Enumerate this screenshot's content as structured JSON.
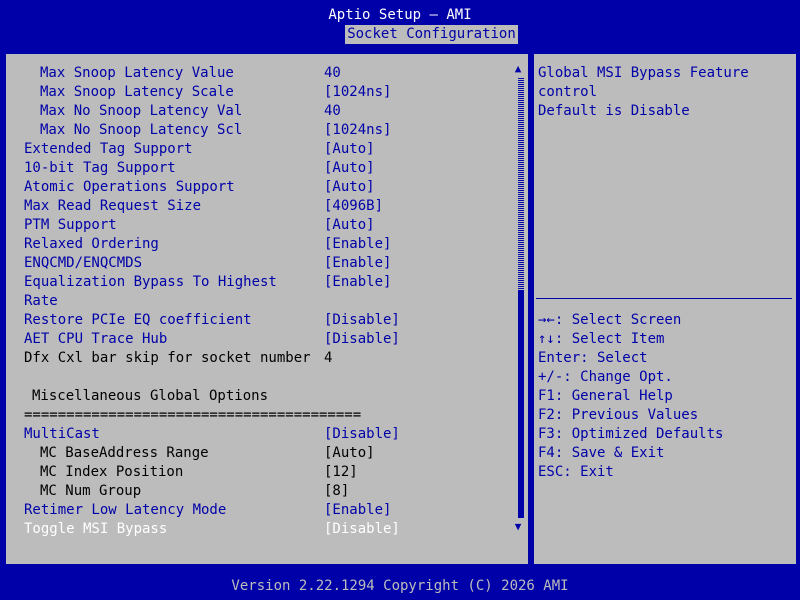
{
  "header": {
    "title": "Aptio Setup – AMI",
    "tab": "Socket Configuration"
  },
  "settings": [
    {
      "label": "Max Snoop Latency Value",
      "value": "40",
      "indent": "ind1",
      "style": "sel"
    },
    {
      "label": "Max Snoop Latency Scale",
      "value": "[1024ns]",
      "indent": "ind1",
      "style": "sel"
    },
    {
      "label": "Max No Snoop Latency Val",
      "value": "40",
      "indent": "ind1",
      "style": "sel"
    },
    {
      "label": "Max No Snoop Latency Scl",
      "value": "[1024ns]",
      "indent": "ind1",
      "style": "sel"
    },
    {
      "label": "Extended Tag Support",
      "value": "[Auto]",
      "indent": "",
      "style": "sel"
    },
    {
      "label": "10-bit Tag Support",
      "value": "[Auto]",
      "indent": "",
      "style": "sel"
    },
    {
      "label": "Atomic Operations Support",
      "value": "[Auto]",
      "indent": "",
      "style": "sel"
    },
    {
      "label": "Max Read Request Size",
      "value": "[4096B]",
      "indent": "",
      "style": "sel"
    },
    {
      "label": "PTM Support",
      "value": "[Auto]",
      "indent": "",
      "style": "sel"
    },
    {
      "label": "Relaxed Ordering",
      "value": "[Enable]",
      "indent": "",
      "style": "sel"
    },
    {
      "label": "ENQCMD/ENQCMDS",
      "value": "[Enable]",
      "indent": "",
      "style": "sel"
    },
    {
      "label": "Equalization Bypass To Highest",
      "value": "[Enable]",
      "indent": "",
      "style": "sel"
    },
    {
      "label": "Rate",
      "value": "",
      "indent": "",
      "style": "sel"
    },
    {
      "label": "Restore PCIe EQ coefficient",
      "value": "[Disable]",
      "indent": "",
      "style": "sel"
    },
    {
      "label": "AET CPU Trace Hub",
      "value": "[Disable]",
      "indent": "",
      "style": "sel"
    },
    {
      "label": "Dfx Cxl bar skip for socket number",
      "value": "4",
      "indent": "",
      "style": "ro"
    },
    {
      "label": "",
      "value": "",
      "indent": "",
      "style": "ro"
    },
    {
      "label": "Miscellaneous Global Options",
      "value": "",
      "indent": "ind0",
      "style": "ro"
    },
    {
      "label": "========================================",
      "value": "",
      "indent": "",
      "style": "ro"
    },
    {
      "label": "MultiCast",
      "value": "[Disable]",
      "indent": "",
      "style": "sel"
    },
    {
      "label": "MC BaseAddress Range",
      "value": "[Auto]",
      "indent": "ind2",
      "style": "ro"
    },
    {
      "label": "MC Index Position",
      "value": "[12]",
      "indent": "ind2",
      "style": "ro"
    },
    {
      "label": "MC Num Group",
      "value": "[8]",
      "indent": "ind2",
      "style": "ro"
    },
    {
      "label": "Retimer Low Latency Mode",
      "value": "[Enable]",
      "indent": "",
      "style": "sel"
    },
    {
      "label": "Toggle MSI Bypass",
      "value": "[Disable]",
      "indent": "",
      "style": "hl"
    }
  ],
  "help": {
    "description": [
      "Global MSI Bypass Feature",
      "control",
      "Default is Disable"
    ],
    "keys": [
      "→←: Select Screen",
      "↑↓: Select Item",
      "Enter: Select",
      "+/-: Change Opt.",
      "F1: General Help",
      "F2: Previous Values",
      "F3: Optimized Defaults",
      "F4: Save & Exit",
      "ESC: Exit"
    ]
  },
  "scroll": {
    "up_glyph": "▲",
    "down_glyph": "▼"
  },
  "footer": {
    "text": "Version 2.22.1294 Copyright (C) 2026 AMI"
  },
  "colors": {
    "background": "#0000a8",
    "panel": "#bcbcbc",
    "selectable_text": "#0000a8",
    "readonly_text": "#000000",
    "highlight_text": "#ffffff"
  }
}
